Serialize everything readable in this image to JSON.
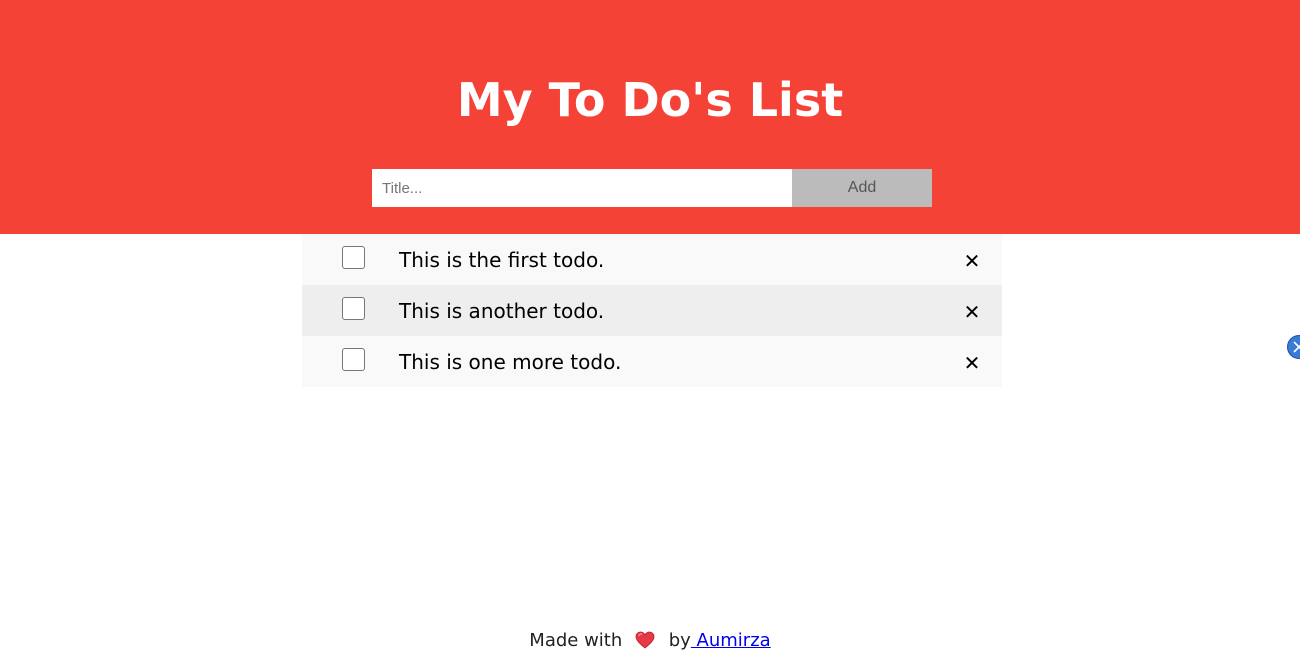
{
  "header": {
    "title": "My To Do's List",
    "background_color": "#f44336"
  },
  "add_form": {
    "input_placeholder": "Title...",
    "input_value": "",
    "add_label": "Add"
  },
  "todos": [
    {
      "text": "This is the first todo.",
      "checked": false
    },
    {
      "text": "This is another todo.",
      "checked": false
    },
    {
      "text": "This is one more todo.",
      "checked": false
    }
  ],
  "delete_glyph": "✕",
  "footer": {
    "made_with": "Made with",
    "heart_icon": "heart-icon",
    "by": "by",
    "author": " Aumirza"
  }
}
